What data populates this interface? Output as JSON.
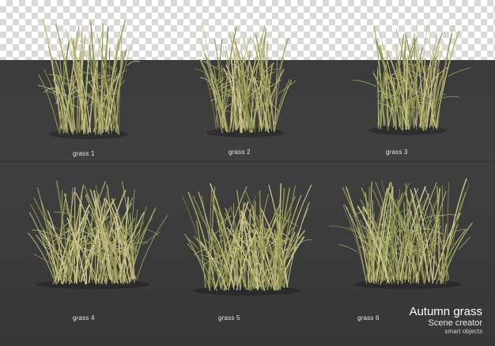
{
  "labels": [
    "grass 1",
    "grass 2",
    "grass 3",
    "grass 4",
    "grass 5",
    "grass 6"
  ],
  "brand": {
    "title": "Autumn grass",
    "subtitle": "Scene creator",
    "tagline": "smart objects"
  }
}
